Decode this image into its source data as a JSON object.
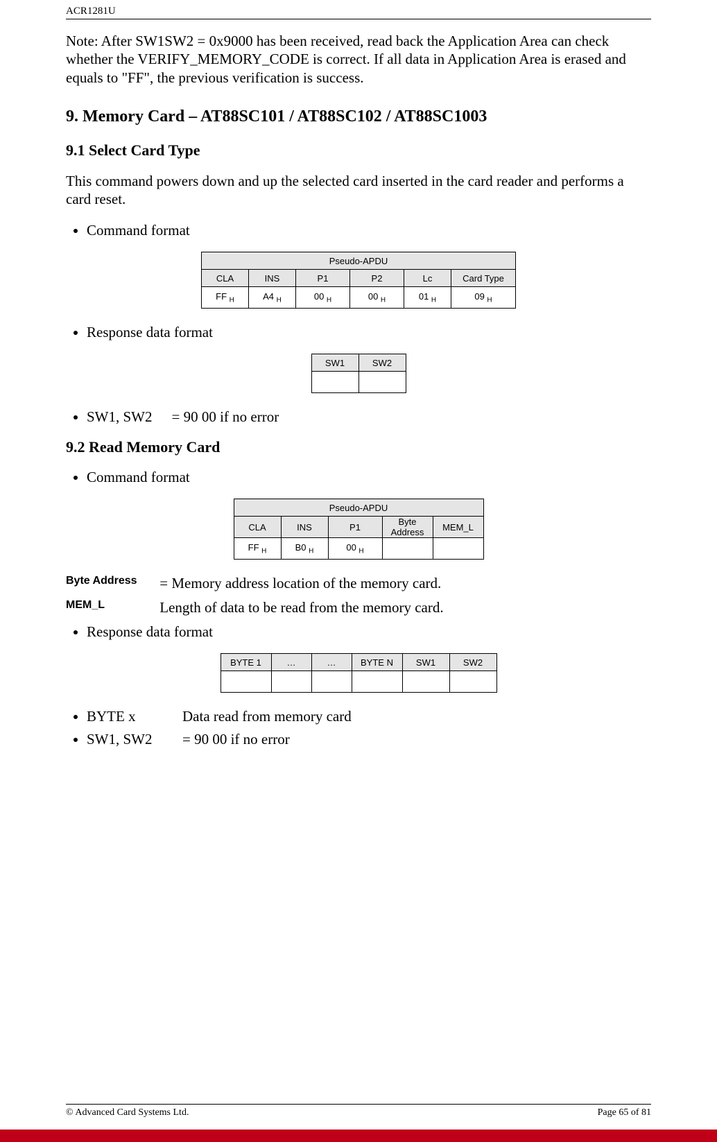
{
  "header": {
    "product": "ACR1281U"
  },
  "note": "Note:  After SW1SW2 = 0x9000 has been received, read back the Application Area can check whether the VERIFY_MEMORY_CODE is correct.  If all data in Application Area is erased and equals to \"FF\", the previous verification is success.",
  "section9": {
    "title": "9. Memory Card – AT88SC101 / AT88SC102 / AT88SC1003",
    "s91": {
      "title": "9.1 Select Card Type",
      "intro": "This command powers down and up the selected card inserted in the card reader and performs a card reset.",
      "bullets": {
        "cmd": "Command format",
        "resp": "Response data format",
        "sw": "SW1, SW2",
        "sw_desc": "= 90 00 if no error"
      },
      "table1": {
        "caption": "Pseudo-APDU",
        "heads": {
          "cla": "CLA",
          "ins": "INS",
          "p1": "P1",
          "p2": "P2",
          "lc": "Lc",
          "ct": "Card Type"
        },
        "row": {
          "cla": "FF ",
          "cla_sub": "H",
          "ins": "A4 ",
          "ins_sub": "H",
          "p1": "00 ",
          "p1_sub": "H",
          "p2": "00 ",
          "p2_sub": "H",
          "lc": "01 ",
          "lc_sub": "H",
          "ct": "09 ",
          "ct_sub": "H"
        }
      },
      "table2": {
        "heads": {
          "sw1": "SW1",
          "sw2": "SW2"
        }
      }
    },
    "s92": {
      "title": "9.2 Read Memory Card",
      "bullets": {
        "cmd": "Command format",
        "resp": "Response data format",
        "byte": "BYTE x",
        "byte_desc": "Data read from memory card",
        "sw": "SW1, SW2",
        "sw_desc": "= 90 00 if no error"
      },
      "table1": {
        "caption": "Pseudo-APDU",
        "heads": {
          "cla": "CLA",
          "ins": "INS",
          "p1": "P1",
          "ba": "Byte Address",
          "mem": "MEM_L"
        },
        "row": {
          "cla": "FF ",
          "cla_sub": "H",
          "ins": "B0 ",
          "ins_sub": "H",
          "p1": "00 ",
          "p1_sub": "H"
        }
      },
      "defs": {
        "ba_label": "Byte Address",
        "ba_eq": " = ",
        "ba_desc": "Memory address location of the memory card.",
        "mem_label": "MEM_L",
        "mem_desc": "Length of data to be read from the memory card."
      },
      "table2": {
        "heads": {
          "b1": "BYTE 1",
          "d1": "…",
          "d2": "…",
          "bn": "BYTE N",
          "sw1": "SW1",
          "sw2": "SW2"
        }
      }
    }
  },
  "footer": {
    "left": "© Advanced Card Systems Ltd.",
    "right": "Page 65 of 81"
  }
}
